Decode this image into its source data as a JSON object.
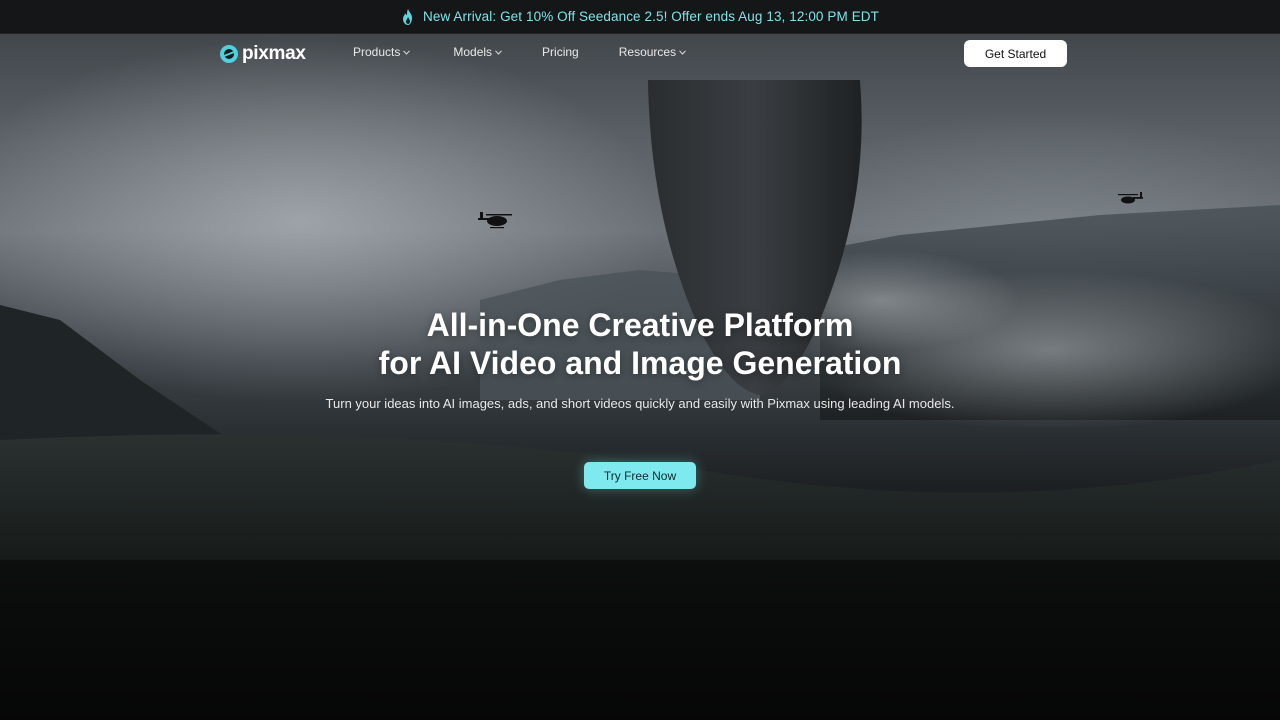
{
  "banner": {
    "icon": "fire-icon",
    "text": "New Arrival: Get 10% Off Seedance 2.5! Offer ends Aug 13, 12:00 PM EDT",
    "text_color": "#7fe3e6"
  },
  "nav": {
    "logo_text": "pixmax",
    "items": [
      {
        "label": "Products",
        "has_dropdown": true
      },
      {
        "label": "Models",
        "has_dropdown": true
      },
      {
        "label": "Pricing",
        "has_dropdown": false
      },
      {
        "label": "Resources",
        "has_dropdown": true
      }
    ],
    "cta_label": "Get Started"
  },
  "hero": {
    "title_line1": "All-in-One Creative Platform",
    "title_line2": "for AI Video and Image Generation",
    "subtitle": "Turn your ideas into AI images, ads, and short videos quickly and easily with Pixmax using leading AI models.",
    "cta_label": "Try Free Now",
    "cta_color": "#7ee9ef"
  }
}
